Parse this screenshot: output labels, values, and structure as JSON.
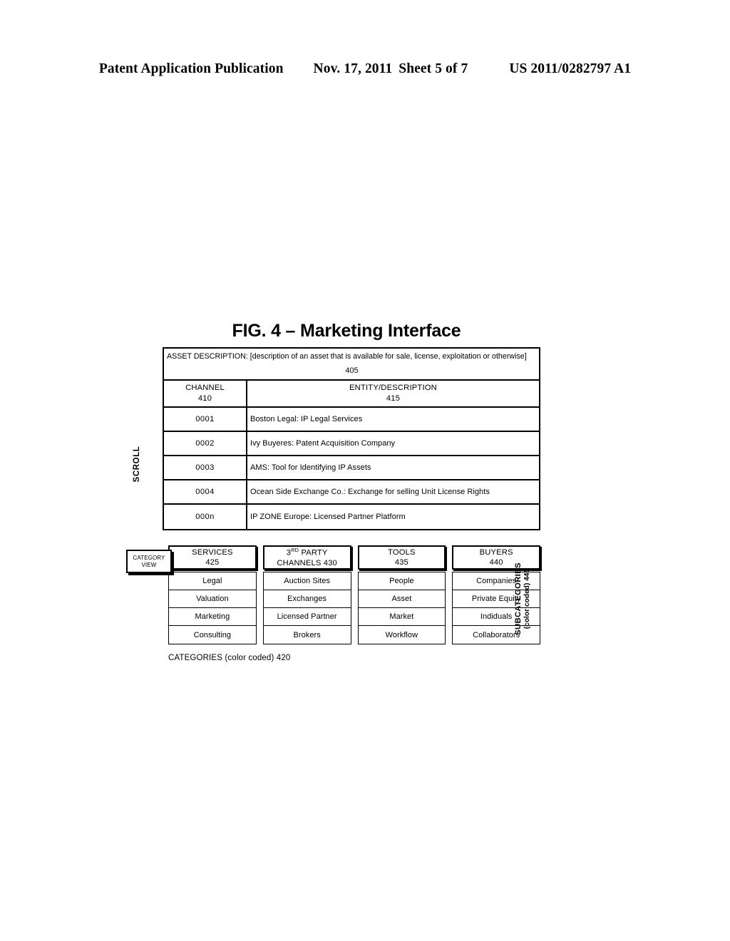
{
  "page_header": {
    "publication": "Patent Application Publication",
    "date": "Nov. 17, 2011",
    "sheet": "Sheet 5 of 7",
    "patent_number": "US 2011/0282797 A1"
  },
  "figure": {
    "title": "FIG. 4 – Marketing Interface",
    "scroll_label": "SCROLL",
    "asset_description": {
      "text": "ASSET DESCRIPTION: [description of an asset that is available for sale, license, exploitation or otherwise]",
      "reference": "405"
    },
    "table": {
      "headers": {
        "channel": "CHANNEL",
        "channel_ref": "410",
        "entity": "ENTITY/DESCRIPTION",
        "entity_ref": "415"
      },
      "rows": [
        {
          "channel": "0001",
          "entity": "Boston Legal: IP Legal Services"
        },
        {
          "channel": "0002",
          "entity": "Ivy Buyeres: Patent Acquisition Company"
        },
        {
          "channel": "0003",
          "entity": "AMS: Tool for Identifying IP Assets"
        },
        {
          "channel": "0004",
          "entity": "Ocean Side Exchange Co.: Exchange for selling Unit License Rights"
        },
        {
          "channel": "000n",
          "entity": "IP ZONE Europe: Licensed Partner Platform"
        }
      ]
    },
    "category_view": {
      "line1": "CATEGORY",
      "line2": "VIEW"
    },
    "categories": [
      {
        "head_line1": "SERVICES",
        "head_line2": "425",
        "items": [
          "Legal",
          "Valuation",
          "Marketing",
          "Consulting"
        ]
      },
      {
        "head_line1_pre": "3",
        "head_line1_sup": "RD",
        "head_line1_post": " PARTY",
        "head_line2": "CHANNELS 430",
        "items": [
          "Auction Sites",
          "Exchanges",
          "Licensed Partner",
          "Brokers"
        ]
      },
      {
        "head_line1": "TOOLS",
        "head_line2": "435",
        "items": [
          "People",
          "Asset",
          "Market",
          "Workflow"
        ]
      },
      {
        "head_line1": "BUYERS",
        "head_line2": "440",
        "items": [
          "Companies",
          "Private Equity",
          "Indiduals",
          "Collaborators"
        ]
      }
    ],
    "subcategories_label": {
      "line1": "SUBCATEGORIES",
      "line2": "(color coded) 445"
    },
    "categories_caption": "CATEGORIES (color coded) 420"
  }
}
